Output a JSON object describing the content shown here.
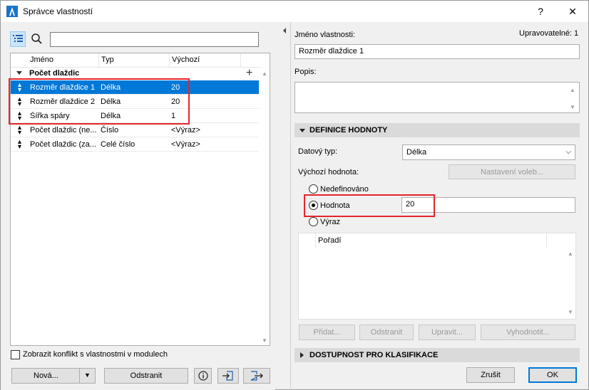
{
  "window": {
    "title": "Správce vlastností",
    "help": "?",
    "close": "✕"
  },
  "left": {
    "search": {
      "value": "",
      "placeholder": ""
    },
    "columns": [
      "Jméno",
      "Typ",
      "Výchozí"
    ],
    "group": {
      "label": "Počet dlaždic",
      "add": "+"
    },
    "rows": [
      {
        "name": "Rozměr dlaždice 1",
        "type": "Délka",
        "default": "20",
        "selected": true
      },
      {
        "name": "Rozměr dlaždice 2",
        "type": "Délka",
        "default": "20",
        "selected": false
      },
      {
        "name": "Šířka spáry",
        "type": "Délka",
        "default": "1",
        "selected": false
      },
      {
        "name": "Počet dlaždic (ne...",
        "type": "Číslo",
        "default": "<Výraz>",
        "selected": false
      },
      {
        "name": "Počet dlaždic (za...",
        "type": "Celé číslo",
        "default": "<Výraz>",
        "selected": false
      }
    ],
    "conflict_label": "Zobrazit konflikt s vlastnostmi v modulech",
    "conflict_checked": false,
    "new_label": "Nová...",
    "delete_label": "Odstranit"
  },
  "right": {
    "name_label": "Jméno vlastnosti:",
    "editable_label": "Upravovatelné: 1",
    "name_value": "Rozměr dlaždice 1",
    "desc_label": "Popis:",
    "desc_value": "",
    "value_def_header": "DEFINICE HODNOTY",
    "data_type_label": "Datový typ:",
    "data_type_value": "Délka",
    "default_value_label": "Výchozí hodnota:",
    "options_button": "Nastavení voleb...",
    "radio_undefined": "Nedefinováno",
    "radio_value": "Hodnota",
    "radio_expression": "Výraz",
    "selected_radio": "Hodnota",
    "value_field": "20",
    "order_header": "Pořadí",
    "btn_add": "Přidat...",
    "btn_remove": "Odstranit",
    "btn_edit": "Upravit...",
    "btn_evaluate": "Vyhodnotit...",
    "availability_header": "DOSTUPNOST PRO KLASIFIKACE",
    "cancel_label": "Zrušit",
    "ok_label": "OK"
  },
  "colors": {
    "selection": "#0078d7",
    "highlight_box": "#e3262c"
  }
}
